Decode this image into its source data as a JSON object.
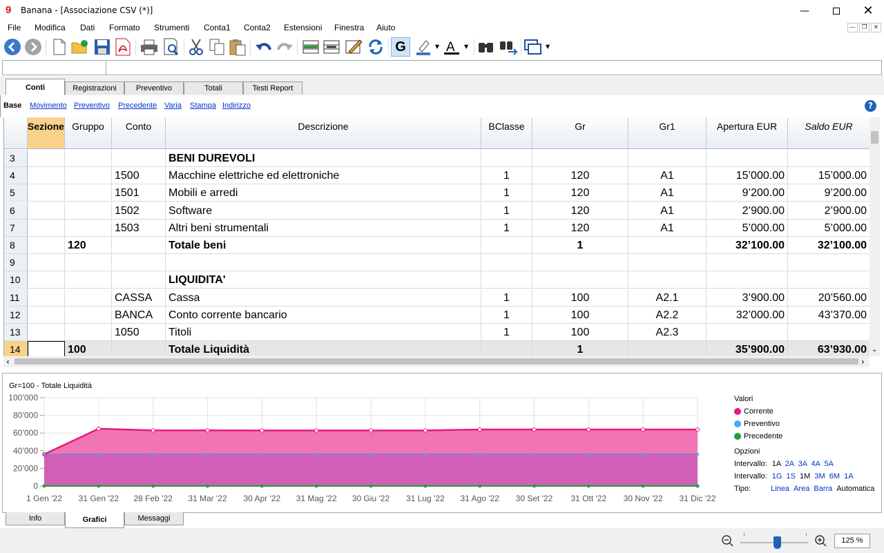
{
  "window": {
    "title": "Banana - [Associazione CSV (*)]"
  },
  "menu": [
    "File",
    "Modifica",
    "Dati",
    "Formato",
    "Strumenti",
    "Conta1",
    "Conta2",
    "Estensioni",
    "Finestra",
    "Aiuto"
  ],
  "tabs": [
    "Conti",
    "Registrazioni",
    "Preventivo",
    "Totali",
    "Testi Report"
  ],
  "views": [
    "Base",
    "Movimento",
    "Preventivo",
    "Precedente",
    "Varia",
    "Stampa",
    "Indirizzo"
  ],
  "table": {
    "headers": [
      "Sezione",
      "Gruppo",
      "Conto",
      "Descrizione",
      "BClasse",
      "Gr",
      "Gr1",
      "Apertura EUR",
      "Saldo EUR"
    ],
    "rows": [
      {
        "n": "3",
        "sez": "",
        "grp": "",
        "conto": "",
        "desc": "BENI DUREVOLI",
        "bc": "",
        "gr": "",
        "gr1": "",
        "ap": "",
        "saldo": "",
        "bold": true
      },
      {
        "n": "4",
        "sez": "",
        "grp": "",
        "conto": "1500",
        "desc": "Macchine elettriche ed elettroniche",
        "bc": "1",
        "gr": "120",
        "gr1": "A1",
        "ap": "15’000.00",
        "saldo": "15’000.00",
        "bold": false
      },
      {
        "n": "5",
        "sez": "",
        "grp": "",
        "conto": "1501",
        "desc": "Mobili e arredi",
        "bc": "1",
        "gr": "120",
        "gr1": "A1",
        "ap": "9’200.00",
        "saldo": "9’200.00",
        "bold": false
      },
      {
        "n": "6",
        "sez": "",
        "grp": "",
        "conto": "1502",
        "desc": "Software",
        "bc": "1",
        "gr": "120",
        "gr1": "A1",
        "ap": "2’900.00",
        "saldo": "2’900.00",
        "bold": false
      },
      {
        "n": "7",
        "sez": "",
        "grp": "",
        "conto": "1503",
        "desc": "Altri beni strumentali",
        "bc": "1",
        "gr": "120",
        "gr1": "A1",
        "ap": "5’000.00",
        "saldo": "5’000.00",
        "bold": false
      },
      {
        "n": "8",
        "sez": "",
        "grp": "120",
        "conto": "",
        "desc": "Totale beni",
        "bc": "",
        "gr": "1",
        "gr1": "",
        "ap": "32’100.00",
        "saldo": "32’100.00",
        "bold": true
      },
      {
        "n": "9",
        "sez": "",
        "grp": "",
        "conto": "",
        "desc": "",
        "bc": "",
        "gr": "",
        "gr1": "",
        "ap": "",
        "saldo": "",
        "bold": false
      },
      {
        "n": "10",
        "sez": "",
        "grp": "",
        "conto": "",
        "desc": "LIQUIDITA'",
        "bc": "",
        "gr": "",
        "gr1": "",
        "ap": "",
        "saldo": "",
        "bold": true
      },
      {
        "n": "11",
        "sez": "",
        "grp": "",
        "conto": "CASSA",
        "desc": "Cassa",
        "bc": "1",
        "gr": "100",
        "gr1": "A2.1",
        "ap": "3’900.00",
        "saldo": "20’560.00",
        "bold": false
      },
      {
        "n": "12",
        "sez": "",
        "grp": "",
        "conto": "BANCA",
        "desc": "Conto corrente bancario",
        "bc": "1",
        "gr": "100",
        "gr1": "A2.2",
        "ap": "32’000.00",
        "saldo": "43’370.00",
        "bold": false
      },
      {
        "n": "13",
        "sez": "",
        "grp": "",
        "conto": "1050",
        "desc": "Titoli",
        "bc": "1",
        "gr": "100",
        "gr1": "A2.3",
        "ap": "",
        "saldo": "",
        "bold": false
      },
      {
        "n": "14",
        "sez": "",
        "grp": "100",
        "conto": "",
        "desc": "Totale Liquidità",
        "bc": "",
        "gr": "1",
        "gr1": "",
        "ap": "35’900.00",
        "saldo": "63’930.00",
        "bold": true,
        "current": true
      }
    ]
  },
  "chart_data": {
    "type": "area",
    "title": "Gr=100 - Totale Liquidità",
    "x": [
      "1 Gen '22",
      "31 Gen '22",
      "28 Feb '22",
      "31 Mar '22",
      "30 Apr '22",
      "31 Mag '22",
      "30 Giu '22",
      "31 Lug '22",
      "31 Ago '22",
      "30 Set '22",
      "31 Ott '22",
      "30 Nov '22",
      "31 Dic '22"
    ],
    "yticks": [
      "100’000",
      "80’000",
      "60’000",
      "40’000",
      "20’000",
      "0"
    ],
    "ylim": [
      0,
      100000
    ],
    "series": [
      {
        "name": "Corrente",
        "color": "#e8177d",
        "values": [
          35900,
          64860,
          63000,
          63000,
          62900,
          62900,
          62900,
          62900,
          63930,
          63930,
          63930,
          63930,
          63930
        ]
      },
      {
        "name": "Preventivo",
        "color": "#4aa8f0",
        "values": [
          35900,
          35900,
          35900,
          35900,
          35900,
          35900,
          35900,
          35900,
          35900,
          35900,
          35900,
          35900,
          35900
        ]
      },
      {
        "name": "Precedente",
        "color": "#22a03a",
        "values": [
          0,
          0,
          0,
          0,
          0,
          0,
          0,
          0,
          0,
          0,
          0,
          0,
          0
        ]
      }
    ]
  },
  "legend": {
    "values_title": "Valori",
    "options_title": "Opzioni",
    "interval_label": "Intervallo:",
    "interval1": [
      "1A",
      "2A",
      "3A",
      "4A",
      "5A"
    ],
    "interval2": [
      "1G",
      "1S",
      "1M",
      "3M",
      "6M",
      "1A"
    ],
    "type_label": "Tipo:",
    "types": [
      "Linea",
      "Area",
      "Barra",
      "Automatica"
    ]
  },
  "bottom_tabs": [
    "Info",
    "Grafici",
    "Messaggi"
  ],
  "zoom": "125 %"
}
